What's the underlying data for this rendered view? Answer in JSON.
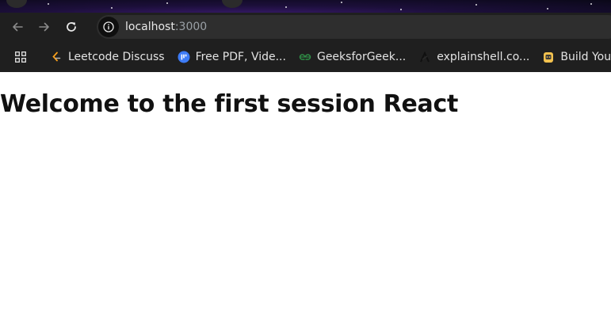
{
  "browser": {
    "url_host": "localhost",
    "url_port": ":3000",
    "bookmarks": [
      {
        "label": "Leetcode Discuss",
        "icon": "leetcode-icon"
      },
      {
        "label": "Free PDF, Vide...",
        "icon": "free-pdf-icon"
      },
      {
        "label": "GeeksforGeek...",
        "icon": "geeksforgeeks-icon"
      },
      {
        "label": "explainshell.co...",
        "icon": "explainshell-icon"
      },
      {
        "label": "Build Your",
        "icon": "build-your-icon"
      }
    ]
  },
  "page": {
    "heading": "Welcome to the first session React"
  },
  "colors": {
    "toolbar_bg": "#1f1f1f",
    "omnibox_bg": "#2e2e2e",
    "page_bg": "#ffffff",
    "heading_color": "#111111"
  }
}
